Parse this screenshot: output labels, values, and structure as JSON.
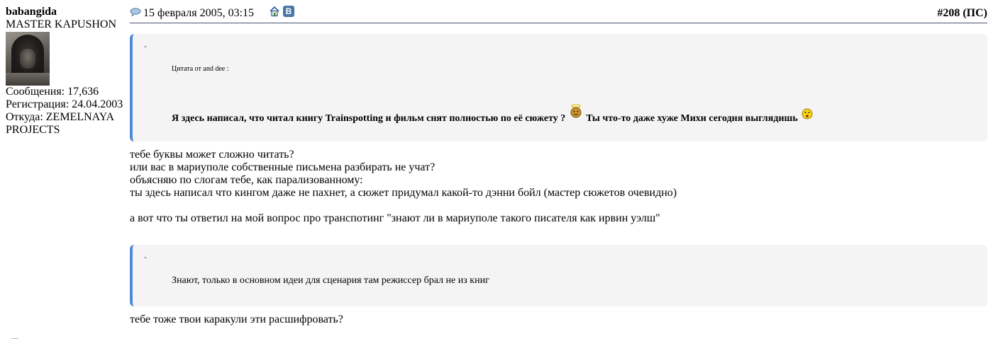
{
  "user": {
    "name": "babangida",
    "title": "MASTER KAPUSHON",
    "posts": "Сообщения: 17,636",
    "registered": "Регистрация: 24.04.2003",
    "location": "Откуда: ZEMELNAYA PROJECTS"
  },
  "post": {
    "icon": "speech-bubble-icon",
    "date": "15 февраля 2005, 03:15",
    "home_icon": "home-icon",
    "vk_label": "B",
    "number": "#208 (ПС)"
  },
  "quote1": {
    "dash": "-",
    "author": "Цитата от and dee :",
    "text_part1": "Я здесь написал, что читал книгу Trainspotting и фильм снят полностью по её сюжету ?",
    "text_part2": "Ты что-то даже хуже Михи сегодня выглядишь"
  },
  "body1": [
    "тебе буквы может сложно читать?",
    "или вас в мариуполе собственные письмена разбирать не учат?",
    "объясняю по слогам тебе, как парализованному:",
    "ты здесь написал что кингом даже не пахнет, а сюжет придумал какой-то дэнни бойл (мастер сюжетов очевидно)",
    "",
    "а вот что ты ответил на мой вопрос про транспотинг \"знают ли в мариуполе такого писателя как ирвин уэлш\""
  ],
  "quote2": {
    "dash": "-",
    "text": "Знают, только в основном идеи для сценария там режиссер брал не из книг"
  },
  "body2": "тебе тоже твои каракули эти расшифровать?",
  "colors": {
    "quote_border": "#4f8ad6",
    "quote_bg": "#f4f4f4",
    "header_rule": "#44506a"
  }
}
